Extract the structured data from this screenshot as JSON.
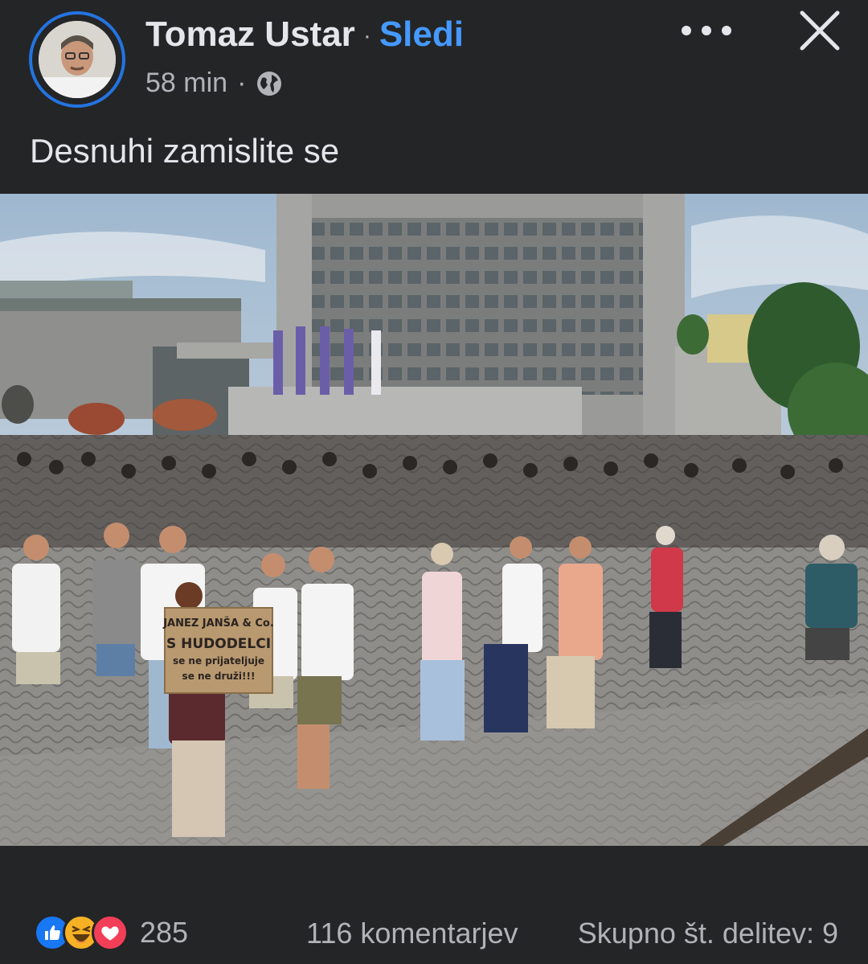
{
  "post": {
    "author": "Tomaz Ustar",
    "separator": "·",
    "follow_label": "Sledi",
    "time": "58 min",
    "meta_dot": "·",
    "privacy_icon": "globe-icon",
    "text": "Desnuhi zamislite se"
  },
  "photo": {
    "sign_text": [
      "JANEZ JANŠA & Co.",
      "S HUDODELCI",
      "se ne prijateljuje",
      "se ne druži!!!"
    ]
  },
  "stats": {
    "reaction_icons": [
      "like-icon",
      "haha-icon",
      "love-icon"
    ],
    "reaction_count": "285",
    "comments": "116 komentarjev",
    "shares": "Skupno št. delitev: 9"
  },
  "colors": {
    "background": "#242526",
    "accent": "#4599ff",
    "avatar_ring": "#2374e1",
    "like": "#1877f2",
    "love": "#f33e58",
    "haha": "#f7b125"
  }
}
